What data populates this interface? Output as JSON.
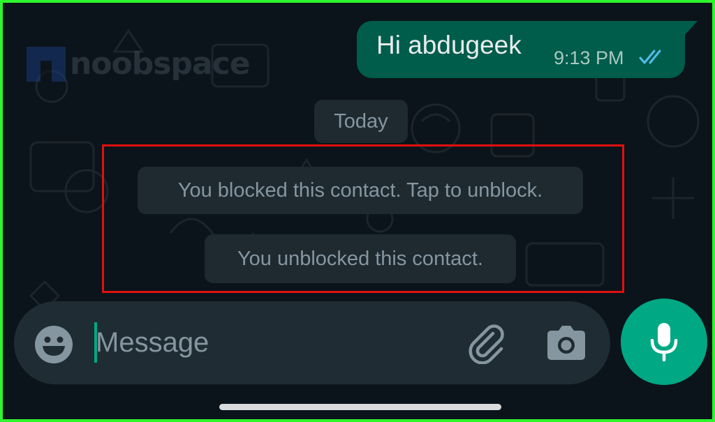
{
  "watermark": {
    "text": "noobspace"
  },
  "outgoing_message": {
    "text": "Hi abdugeek",
    "time": "9:13 PM",
    "status_icon": "double-check-read-icon"
  },
  "date_divider": {
    "label": "Today"
  },
  "system_messages": [
    {
      "text": "You blocked this contact. Tap to unblock."
    },
    {
      "text": "You unblocked this contact."
    }
  ],
  "composer": {
    "placeholder": "Message",
    "value": "",
    "icons": {
      "emoji": "emoji-icon",
      "attach": "paperclip-icon",
      "camera": "camera-icon",
      "mic": "microphone-icon"
    }
  },
  "colors": {
    "background": "#0b141a",
    "outgoing_bubble": "#005c4b",
    "system_pill": "#1e2a30",
    "accent": "#00a884",
    "highlight": "#e01010",
    "frame_border": "#2ef52e",
    "read_ticks": "#53bdeb"
  }
}
